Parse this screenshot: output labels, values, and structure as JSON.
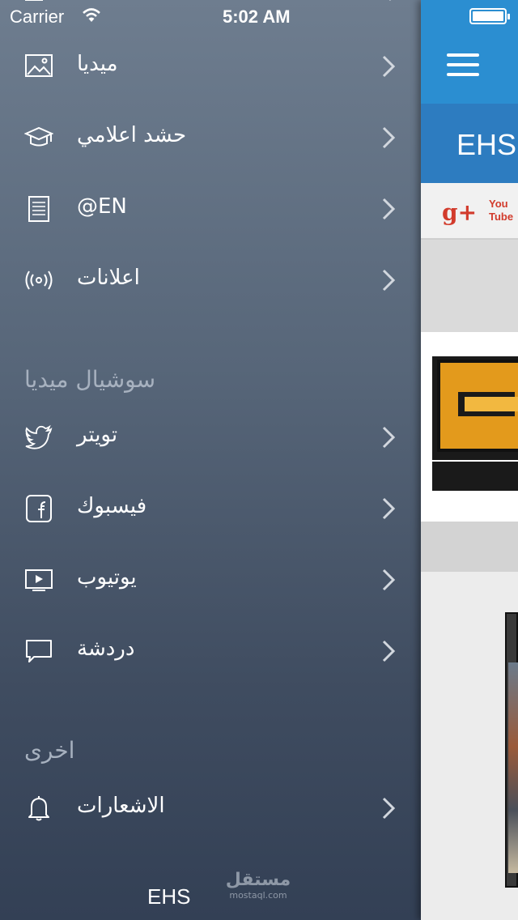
{
  "status_bar": {
    "carrier": "Carrier",
    "time": "5:02 AM"
  },
  "menu": {
    "items": [
      {
        "label": "ميديا",
        "icon": "image-icon"
      },
      {
        "label": "حشد اعلامي",
        "icon": "graduation-cap-icon"
      },
      {
        "label": "@EN",
        "icon": "document-icon"
      },
      {
        "label": "اعلانات",
        "icon": "broadcast-icon"
      }
    ],
    "social_header": "سوشيال ميديا",
    "social_items": [
      {
        "label": "تويتر",
        "icon": "twitter-icon"
      },
      {
        "label": "فيسبوك",
        "icon": "facebook-icon"
      },
      {
        "label": "يوتيوب",
        "icon": "video-play-icon"
      },
      {
        "label": "دردشة",
        "icon": "chat-bubble-icon"
      }
    ],
    "other_header": "اخرى",
    "other_items": [
      {
        "label": "الاشعارات",
        "icon": "bell-icon"
      }
    ],
    "footer": "EHS"
  },
  "watermark": {
    "arabic": "مستقل",
    "latin": "mostaql.com"
  },
  "main": {
    "title": "EHS",
    "social_icons": {
      "gplus": "g+",
      "youtube_top": "You",
      "youtube_bottom": "Tube"
    }
  },
  "colors": {
    "navbar": "#2b8ed1",
    "titlebar": "#2d7cc0",
    "accent_red": "#d23b2c",
    "logo_orange": "#e39a1c"
  }
}
